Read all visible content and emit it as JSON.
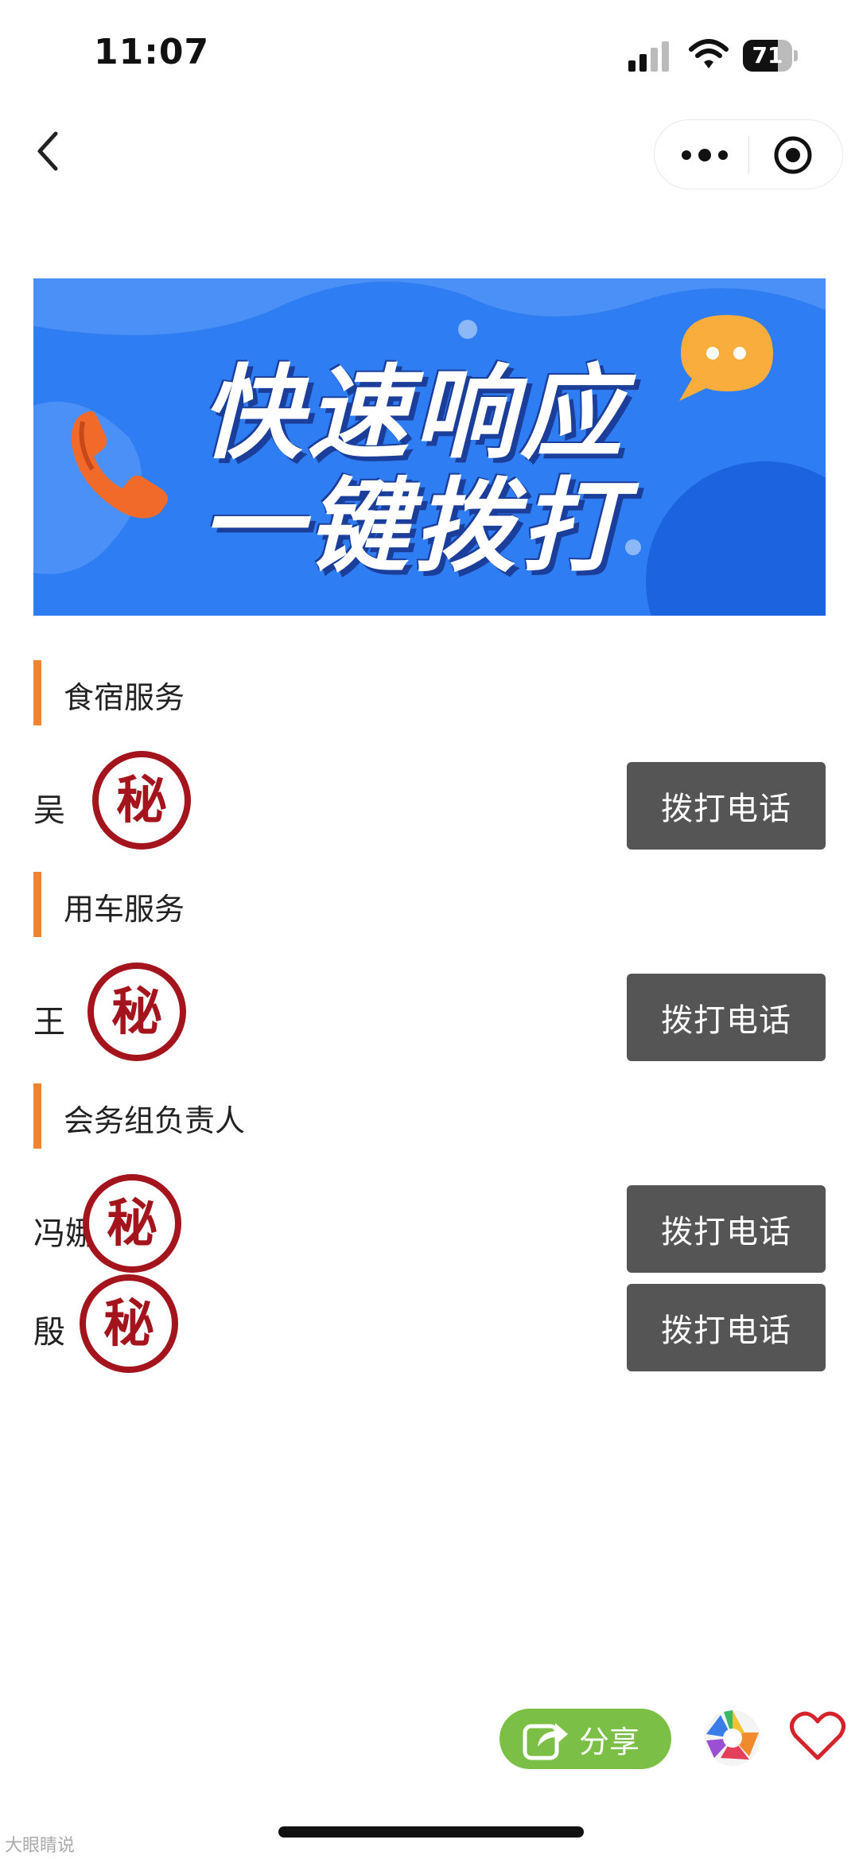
{
  "status_bar": {
    "time": "11:07",
    "battery": "71",
    "battery_level": 0.71
  },
  "banner": {
    "line1": "快速响应",
    "line2": "一键拨打"
  },
  "sections": [
    {
      "title": "食宿服务",
      "contacts": [
        {
          "name": "吴",
          "button": "拨打电话"
        }
      ]
    },
    {
      "title": "用车服务",
      "contacts": [
        {
          "name": "王",
          "button": "拨打电话"
        }
      ]
    },
    {
      "title": "会务组负责人",
      "contacts": [
        {
          "name": "冯娜",
          "button": "拨打电话"
        },
        {
          "name": "殷",
          "button": "拨打电话"
        }
      ]
    }
  ],
  "stamp_text": "秘",
  "bottom": {
    "share_label": "分享"
  },
  "watermark": "大眼睛说",
  "colors": {
    "accent_bar": "#f08332",
    "button_bg": "#555555",
    "stamp": "#a3141c",
    "share": "#7bbf47",
    "banner": "#2f7df2"
  },
  "icons": [
    "back-icon",
    "more-dots-icon",
    "target-icon",
    "phone-icon",
    "chat-bubble-icon",
    "share-icon",
    "aperture-icon",
    "heart-icon"
  ]
}
